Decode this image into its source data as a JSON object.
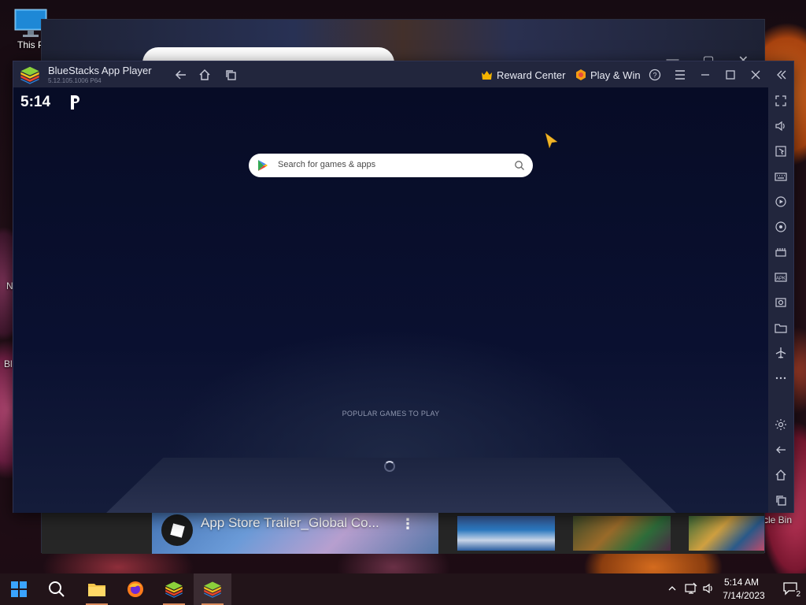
{
  "desktop": {
    "icons": [
      {
        "label": "This PC"
      },
      {
        "label": "BlueStacks"
      }
    ],
    "partial_labels": {
      "left_n": "N",
      "left_bl": "Bl",
      "recycle": "cle Bin",
      "this_pc": "This P"
    }
  },
  "background_window": {
    "video_title": "App Store Trailer_Global Co...",
    "more": "⋮",
    "roblox_text": "ROBLOX"
  },
  "bluestacks": {
    "title": "BlueStacks App Player",
    "version": "5.12.105.1006  P64",
    "reward_center": "Reward Center",
    "play_win": "Play & Win",
    "colors": {
      "accent": "#22263d",
      "screen_bg": "#070c26",
      "play_win_orange": "#f39c12",
      "crown": "#f5b400"
    }
  },
  "android": {
    "clock": "5:14",
    "search_placeholder": "Search for games & apps",
    "popular_label": "POPULAR GAMES TO PLAY"
  },
  "taskbar": {
    "time": "5:14 AM",
    "date": "7/14/2023",
    "notification_count": "2"
  }
}
